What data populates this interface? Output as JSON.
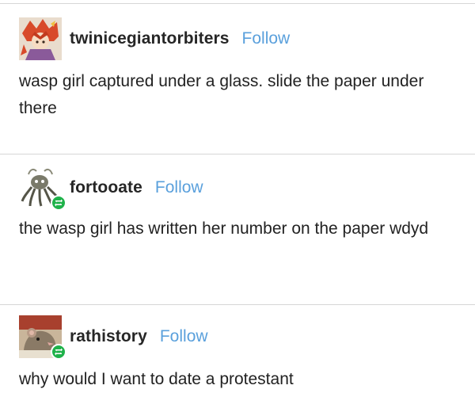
{
  "posts": [
    {
      "username": "twinicegiantorbiters",
      "follow_label": "Follow",
      "text": "wasp girl captured under a glass. slide the paper under there",
      "avatar_icon": "anime-character-avatar-icon",
      "reblogged": false
    },
    {
      "username": "fortooate",
      "follow_label": "Follow",
      "text": "the wasp girl has written her number on the paper wdyd",
      "avatar_icon": "squid-monster-avatar-icon",
      "reblogged": true
    },
    {
      "username": "rathistory",
      "follow_label": "Follow",
      "text": "why would I want to date a protestant",
      "avatar_icon": "rat-avatar-icon",
      "reblogged": true
    }
  ],
  "colors": {
    "follow_link": "#5aa0dc",
    "reblog_badge": "#1fb24a",
    "divider": "#d6d6d6"
  }
}
